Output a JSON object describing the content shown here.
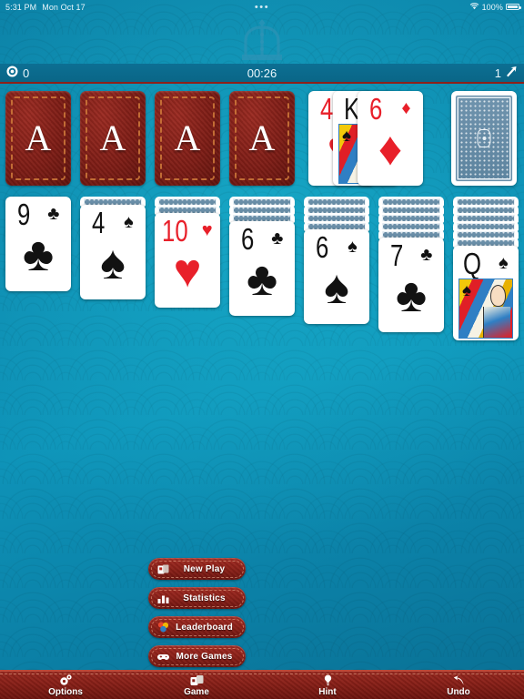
{
  "status_bar": {
    "time": "5:31 PM",
    "date": "Mon Oct 17",
    "center_dots": "•••",
    "battery_percent": "100%",
    "wifi_icon": "wifi-icon",
    "battery_icon": "battery-full-icon"
  },
  "branding": {
    "logo_icon": "crown-logo-icon"
  },
  "game_bar": {
    "score_icon": "target-score-icon",
    "score": "0",
    "timer": "00:26",
    "moves": "1",
    "moves_icon": "moves-flag-icon"
  },
  "foundations": [
    {
      "name": "foundation-1",
      "placeholder": "A"
    },
    {
      "name": "foundation-2",
      "placeholder": "A"
    },
    {
      "name": "foundation-3",
      "placeholder": "A"
    },
    {
      "name": "foundation-4",
      "placeholder": "A"
    }
  ],
  "waste": [
    {
      "rank": "4",
      "suit": "♥",
      "color": "red",
      "face": false
    },
    {
      "rank": "K",
      "suit": "♠",
      "color": "black",
      "face": true
    },
    {
      "rank": "6",
      "suit": "♦",
      "color": "red",
      "face": false
    }
  ],
  "stock": {
    "icon": "card-back-icon",
    "label": "stock-pile"
  },
  "tableau": [
    {
      "hidden": 0,
      "rank": "9",
      "suit": "♣",
      "color": "black",
      "face": false
    },
    {
      "hidden": 1,
      "rank": "4",
      "suit": "♠",
      "color": "black",
      "face": false
    },
    {
      "hidden": 2,
      "rank": "10",
      "suit": "♥",
      "color": "red",
      "face": false
    },
    {
      "hidden": 3,
      "rank": "6",
      "suit": "♣",
      "color": "black",
      "face": false
    },
    {
      "hidden": 4,
      "rank": "6",
      "suit": "♠",
      "color": "black",
      "face": false
    },
    {
      "hidden": 5,
      "rank": "7",
      "suit": "♣",
      "color": "black",
      "face": false
    },
    {
      "hidden": 6,
      "rank": "Q",
      "suit": "♠",
      "color": "black",
      "face": true
    }
  ],
  "menu": [
    {
      "label": "New Play",
      "icon": "new-cards-icon"
    },
    {
      "label": "Statistics",
      "icon": "bar-chart-icon"
    },
    {
      "label": "Leaderboard",
      "icon": "podium-icon"
    },
    {
      "label": "More Games",
      "icon": "gamepad-icon"
    }
  ],
  "toolbar": [
    {
      "label": "Options",
      "icon": "gears-icon"
    },
    {
      "label": "Game",
      "icon": "dice-icon"
    },
    {
      "label": "Hint",
      "icon": "lightbulb-icon"
    },
    {
      "label": "Undo",
      "icon": "undo-arrow-icon"
    }
  ],
  "colors": {
    "felt": "#0d86ac",
    "card_red": "#e8202a",
    "card_black": "#121212",
    "toolbar_red": "#8a2018",
    "foundation_red": "#7e1d16"
  }
}
